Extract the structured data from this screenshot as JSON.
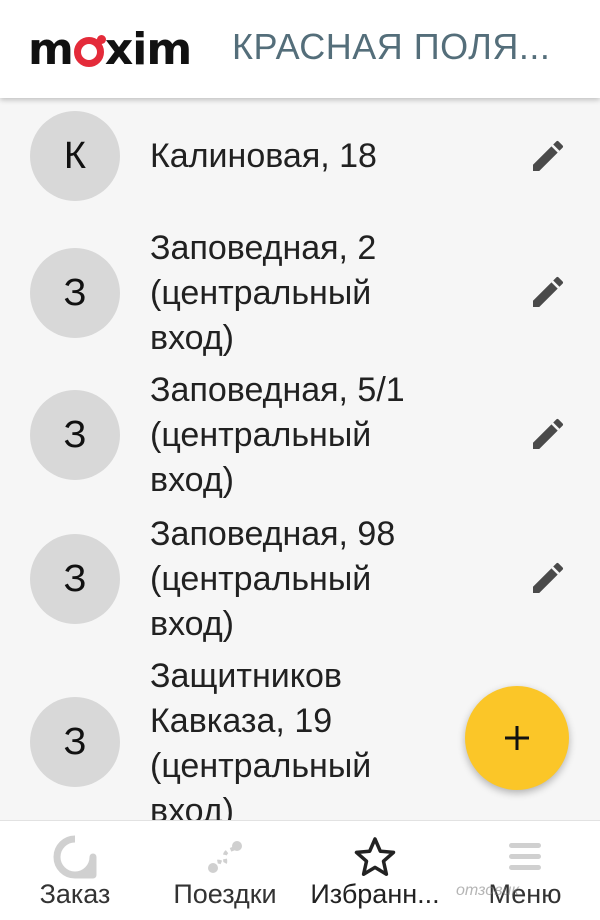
{
  "header": {
    "logo_text_before": "m",
    "logo_text_after": "xim",
    "city": "КРАСНАЯ ПОЛЯ..."
  },
  "favorites": [
    {
      "initial": "К",
      "lines": [
        "Калиновая, 18"
      ]
    },
    {
      "initial": "З",
      "lines": [
        "Заповедная, 2",
        "(центральный",
        "вход)"
      ]
    },
    {
      "initial": "З",
      "lines": [
        "Заповедная, 5/1",
        "(центральный",
        "вход)"
      ]
    },
    {
      "initial": "З",
      "lines": [
        "Заповедная, 98",
        "(центральный",
        "вход)"
      ]
    },
    {
      "initial": "З",
      "lines": [
        "Защитников",
        "Кавказа, 19",
        "(центральный",
        "вход)"
      ]
    }
  ],
  "fab": {
    "icon": "plus-icon",
    "label": "+"
  },
  "bottom_nav": {
    "items": [
      {
        "label": "Заказ",
        "icon": "order-icon",
        "active": false
      },
      {
        "label": "Поездки",
        "icon": "trips-icon",
        "active": false
      },
      {
        "label": "Избранн...",
        "icon": "star-icon",
        "active": true
      },
      {
        "label": "Меню",
        "icon": "menu-icon",
        "active": false
      }
    ]
  },
  "watermark": "отзовик",
  "colors": {
    "logo_accent": "#e42b3a",
    "fab": "#fbc628",
    "city_text": "#546e7a",
    "avatar_bg": "#d8d8d8",
    "icon_gray": "#4a4a4a",
    "inactive_icon": "#d0d0d0"
  }
}
